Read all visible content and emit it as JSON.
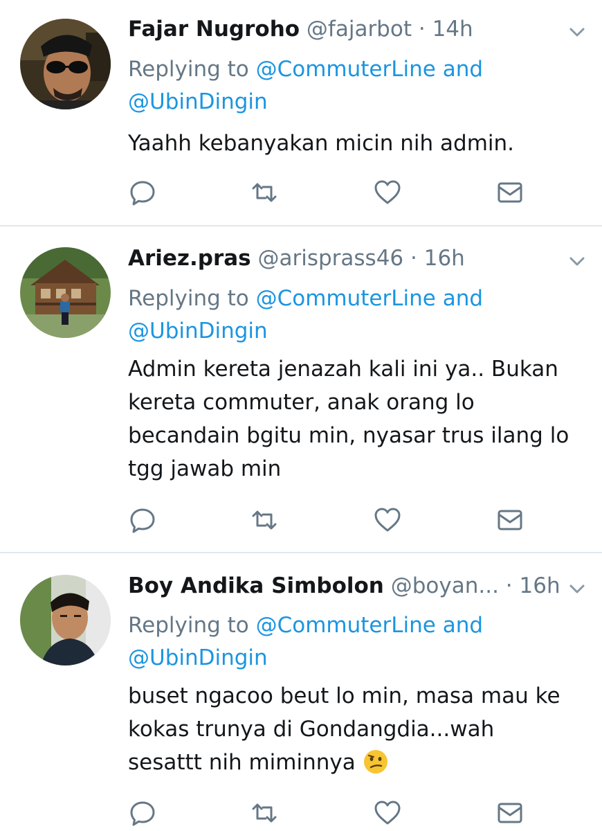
{
  "tweets": [
    {
      "name": "Fajar Nugroho",
      "handle": "@fajarbot",
      "dot": " · ",
      "time": "14h",
      "replying_prefix": "Replying to ",
      "mention1": "@CommuterLine",
      "and": " and",
      "mention2": "@UbinDingin",
      "lines": [
        "Yaahh kebanyakan micin nih admin."
      ]
    },
    {
      "name": "Ariez.pras",
      "handle": "@arisprass46",
      "dot": " · ",
      "time": "16h",
      "replying_prefix": "Replying to ",
      "mention1": "@CommuterLine",
      "and": " and",
      "mention2": "@UbinDingin",
      "lines": [
        "Admin kereta jenazah kali ini ya.. Bukan",
        "kereta commuter, anak orang lo",
        "becandain bgitu min, nyasar trus ilang lo",
        "tgg jawab min"
      ]
    },
    {
      "name": "Boy Andika Simbolon",
      "handle": "@boyan...",
      "dot": " · ",
      "time": "16h",
      "replying_prefix": "Replying to ",
      "mention1": "@CommuterLine",
      "and": " and",
      "mention2": "@UbinDingin",
      "lines": [
        "buset ngacoo beut lo min, masa mau ke",
        "kokas trunya di Gondangdia...wah",
        "sesattt nih miminnya"
      ],
      "emoji": "confused-face"
    }
  ],
  "icons": [
    "reply-icon",
    "retweet-icon",
    "like-icon",
    "message-icon",
    "chevron-down-icon"
  ],
  "colors": {
    "name": "#14171a",
    "muted": "#657786",
    "link": "#1b95e0",
    "divider": "#e1e8ed"
  }
}
